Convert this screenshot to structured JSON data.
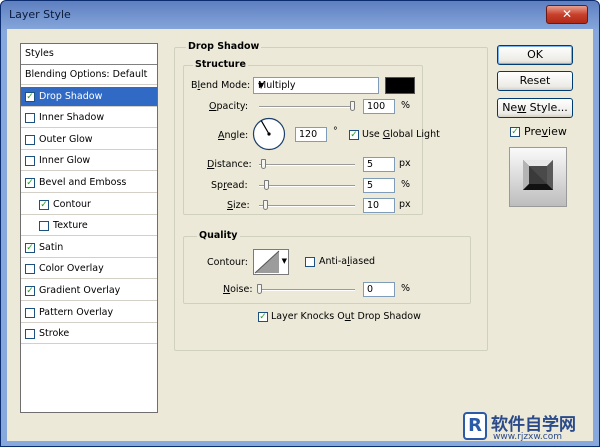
{
  "window": {
    "title": "Layer Style",
    "close_glyph": "✕"
  },
  "styles_panel": {
    "header": "Styles",
    "items": [
      {
        "label": "Blending Options: Default",
        "checkbox": false,
        "checked": false,
        "selected": false,
        "indent": 0
      },
      {
        "label": "Drop Shadow",
        "checkbox": true,
        "checked": true,
        "selected": true,
        "indent": 0
      },
      {
        "label": "Inner Shadow",
        "checkbox": true,
        "checked": false,
        "selected": false,
        "indent": 0
      },
      {
        "label": "Outer Glow",
        "checkbox": true,
        "checked": false,
        "selected": false,
        "indent": 0
      },
      {
        "label": "Inner Glow",
        "checkbox": true,
        "checked": false,
        "selected": false,
        "indent": 0
      },
      {
        "label": "Bevel and Emboss",
        "checkbox": true,
        "checked": true,
        "selected": false,
        "indent": 0
      },
      {
        "label": "Contour",
        "checkbox": true,
        "checked": true,
        "selected": false,
        "indent": 1
      },
      {
        "label": "Texture",
        "checkbox": true,
        "checked": false,
        "selected": false,
        "indent": 1
      },
      {
        "label": "Satin",
        "checkbox": true,
        "checked": true,
        "selected": false,
        "indent": 0
      },
      {
        "label": "Color Overlay",
        "checkbox": true,
        "checked": false,
        "selected": false,
        "indent": 0
      },
      {
        "label": "Gradient Overlay",
        "checkbox": true,
        "checked": true,
        "selected": false,
        "indent": 0
      },
      {
        "label": "Pattern Overlay",
        "checkbox": true,
        "checked": false,
        "selected": false,
        "indent": 0
      },
      {
        "label": "Stroke",
        "checkbox": true,
        "checked": false,
        "selected": false,
        "indent": 0
      }
    ]
  },
  "drop_shadow": {
    "title": "Drop Shadow",
    "structure": {
      "title": "Structure",
      "blend_mode_label_pre": "B",
      "blend_mode_label_ul": "l",
      "blend_mode_label_post": "end Mode:",
      "blend_mode_value": "Multiply",
      "shadow_color": "#000000",
      "opacity_label_ul": "O",
      "opacity_label_post": "pacity:",
      "opacity_value": "100",
      "opacity_unit": "%",
      "opacity_fraction": 1.0,
      "angle_label_ul": "A",
      "angle_label_post": "ngle:",
      "angle_value": "120",
      "angle_unit": "°",
      "global_light_pre": "Use ",
      "global_light_ul": "G",
      "global_light_post": "lobal Light",
      "global_light_checked": true,
      "distance_label_ul": "D",
      "distance_label_post": "istance:",
      "distance_value": "5",
      "distance_unit": "px",
      "distance_fraction": 0.02,
      "spread_label_pre": "Sp",
      "spread_label_ul": "r",
      "spread_label_post": "ead:",
      "spread_value": "5",
      "spread_unit": "%",
      "spread_fraction": 0.05,
      "size_label_ul": "S",
      "size_label_post": "ize:",
      "size_value": "10",
      "size_unit": "px",
      "size_fraction": 0.04
    },
    "quality": {
      "title": "Quality",
      "contour_label": "Contour:",
      "anti_aliased_pre": "Anti-a",
      "anti_aliased_ul": "l",
      "anti_aliased_post": "iased",
      "anti_aliased_checked": false,
      "noise_label_ul": "N",
      "noise_label_post": "oise:",
      "noise_value": "0",
      "noise_unit": "%",
      "noise_fraction": 0.0
    },
    "knockout_pre": "Layer Knocks O",
    "knockout_ul": "u",
    "knockout_post": "t Drop Shadow",
    "knockout_checked": true
  },
  "buttons": {
    "ok": "OK",
    "reset": "Reset",
    "new_style_pre": "Ne",
    "new_style_ul": "w",
    "new_style_post": " Style...",
    "preview_pre": "Pre",
    "preview_ul": "v",
    "preview_post": "iew",
    "preview_checked": true
  },
  "watermark": {
    "brand": "软件自学网",
    "url": "www.rjzxw.com",
    "logo": "R"
  },
  "check_glyph": "✓",
  "colors": {
    "selection": "#316ac5",
    "dialog_bg": "#ece9d8",
    "titlebar": "#5e7fc0"
  }
}
